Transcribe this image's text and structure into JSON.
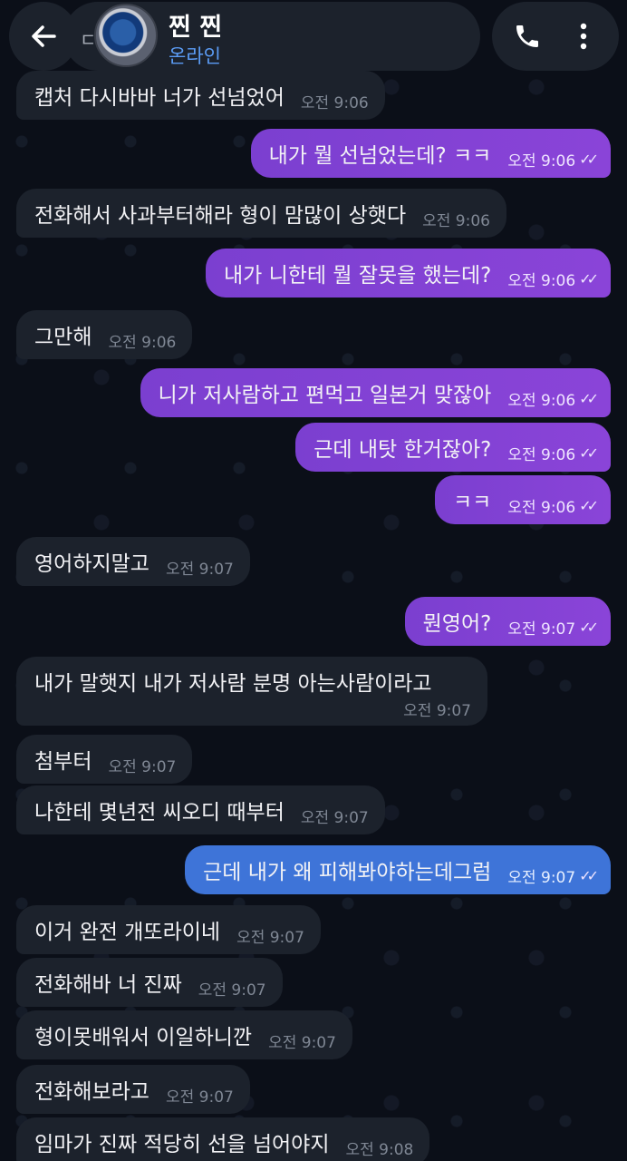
{
  "header": {
    "contact_name": "찐 찐",
    "status": "온라인",
    "partial_char": "ㄷ"
  },
  "messages": [
    {
      "dir": "in",
      "text": "캡처 다시바바 너가 선넘었어",
      "time": "오전 9:06"
    },
    {
      "dir": "out",
      "text": "내가 뭘 선넘었는데? ㅋㅋ",
      "time": "오전 9:06",
      "read": true
    },
    {
      "dir": "in",
      "text": "전화해서 사과부터해라 형이 맘많이 상햇다",
      "time": "오전 9:06"
    },
    {
      "dir": "out",
      "text": "내가 니한테 뭘 잘못을 했는데?",
      "time": "오전 9:06",
      "read": true
    },
    {
      "dir": "in",
      "text": "그만해",
      "time": "오전 9:06"
    },
    {
      "dir": "out",
      "text": "니가 저사람하고 편먹고 일본거 맞잖아",
      "time": "오전 9:06",
      "read": true
    },
    {
      "dir": "out",
      "text": "근데 내탓 한거잖아?",
      "time": "오전 9:06",
      "read": true
    },
    {
      "dir": "out",
      "text": "ㅋㅋ",
      "time": "오전 9:06",
      "read": true
    },
    {
      "dir": "in",
      "text": "영어하지말고",
      "time": "오전 9:07"
    },
    {
      "dir": "out",
      "text": "뭔영어?",
      "time": "오전 9:07",
      "read": true
    },
    {
      "dir": "in",
      "text": "내가 말햇지 내가 저사람 분명 아는사람이라고",
      "time": "오전 9:07"
    },
    {
      "dir": "in",
      "text": "첨부터",
      "time": "오전 9:07"
    },
    {
      "dir": "in",
      "text": "나한테 몇년전 씨오디 때부터",
      "time": "오전 9:07"
    },
    {
      "dir": "out",
      "text": "근데 내가 왜 피해봐야하는데그럼",
      "time": "오전 9:07",
      "read": true,
      "color": "blue"
    },
    {
      "dir": "in",
      "text": "이거 완전 개또라이네",
      "time": "오전 9:07"
    },
    {
      "dir": "in",
      "text": "전화해바 너 진짜",
      "time": "오전 9:07"
    },
    {
      "dir": "in",
      "text": "형이못배워서 이일하니깐",
      "time": "오전 9:07"
    },
    {
      "dir": "in",
      "text": "전화해보라고",
      "time": "오전 9:07"
    },
    {
      "dir": "in",
      "text": "임마가 진짜 적당히 선을 넘어야지",
      "time": "오전 9:08"
    }
  ],
  "colors": {
    "incoming": "#1c222c",
    "outgoing": "#8a44d8",
    "outgoing_alt": "#3e74d8",
    "status": "#5b9cf5"
  },
  "icons": {
    "back": "arrow-left-icon",
    "call": "phone-icon",
    "menu": "more-vertical-icon",
    "read": "double-check-icon"
  }
}
